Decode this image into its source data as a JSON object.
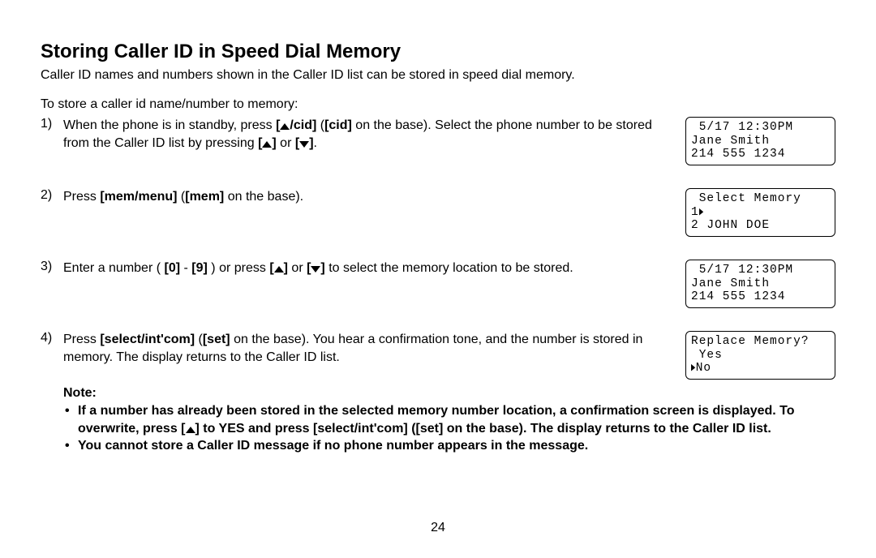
{
  "heading": "Storing Caller ID in Speed Dial Memory",
  "intro": "Caller ID names and numbers shown in the Caller ID list can be stored in speed dial memory.",
  "pre_list": "To store a caller id name/number to memory:",
  "steps": {
    "s1": {
      "num": "1)",
      "pre": "When the phone is in standby, press ",
      "b1a": "[",
      "b1b": "/cid]",
      "mid1": " (",
      "b2": "[cid]",
      "mid2": " on the base). Select the phone number to be stored from the Caller ID list by pressing ",
      "b3a": "[",
      "b3b": "]",
      "or": " or ",
      "b4a": "[",
      "b4b": "]",
      "end": "."
    },
    "s2": {
      "num": "2)",
      "pre": "Press ",
      "b1": "[mem/menu]",
      "mid": " (",
      "b2": "[mem]",
      "end": " on the base)."
    },
    "s3": {
      "num": "3)",
      "pre": "Enter a number ( ",
      "b1": "[0]",
      "dash": " - ",
      "b2": "[9]",
      "mid": " ) or press ",
      "b3a": "[",
      "b3b": "]",
      "or": " or ",
      "b4a": "[",
      "b4b": "]",
      "end": " to select the memory location to be stored."
    },
    "s4": {
      "num": "4)",
      "pre": "Press ",
      "b1": "[select/int'com]",
      "mid1": " (",
      "b2": "[set]",
      "end": " on the base). You hear a confirmation tone, and the number is stored in memory. The display returns to the Caller ID list."
    }
  },
  "lcd": {
    "l1": {
      "line1": " 5/17 12:30PM",
      "line2": "Jane Smith",
      "line3": "214 555 1234"
    },
    "l2": {
      "line1": " Select Memory",
      "line2": "1",
      "line3": "2 JOHN DOE"
    },
    "l3": {
      "line1": " 5/17 12:30PM",
      "line2": "Jane Smith",
      "line3": "214 555 1234"
    },
    "l4": {
      "line1": "Replace Memory?",
      "line2": " Yes",
      "line3": "No"
    }
  },
  "note_label": "Note:",
  "notes": {
    "n1a": "If a number has already been stored in the selected memory number location, a confirmation screen is displayed. To overwrite, press [",
    "n1b": "] to YES and press [select/int'com] ([set] on the base). The display returns to the Caller ID list.",
    "n2": "You cannot store a Caller ID message if no phone number appears in the message."
  },
  "pagenum": "24"
}
